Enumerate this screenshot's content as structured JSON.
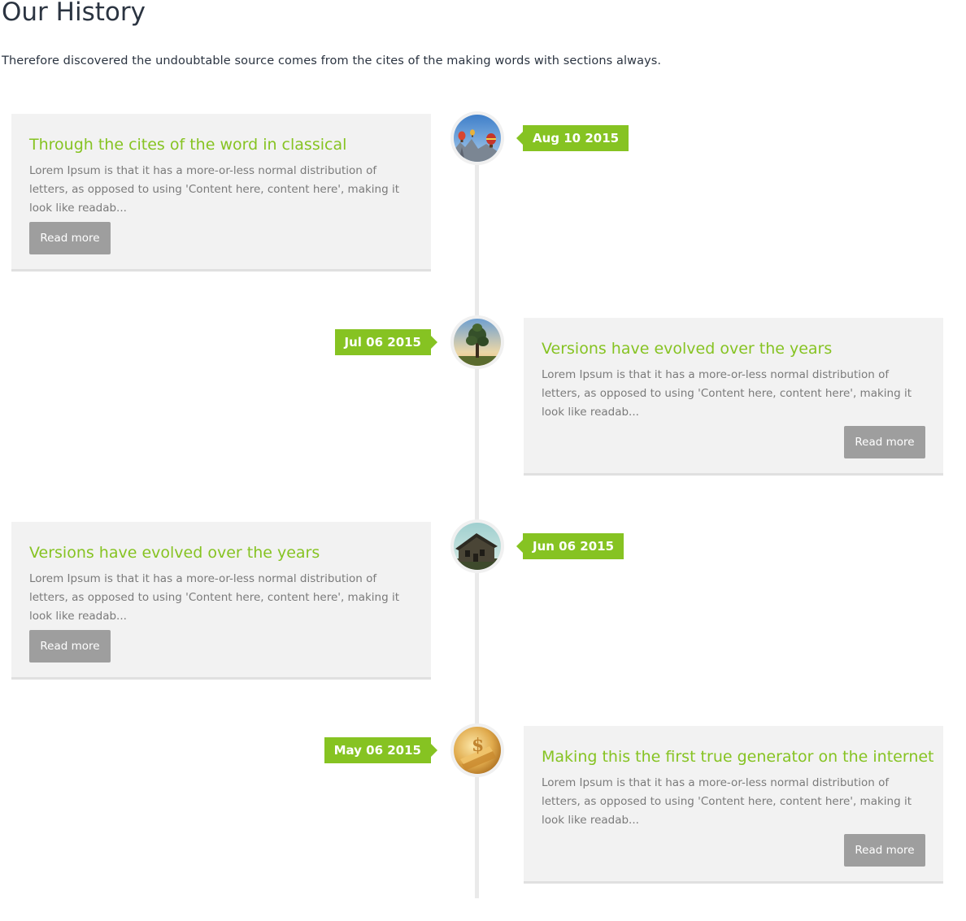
{
  "page": {
    "title": "Our History",
    "intro": "Therefore discovered the undoubtable source comes from the cites of the making words with sections always."
  },
  "theme": {
    "accent": "#86c322",
    "card_background": "#f2f2f2",
    "button_background": "#9e9e9e",
    "text_muted": "#7a7a7a"
  },
  "timeline": {
    "items": [
      {
        "side": "left",
        "date": "Aug 10 2015",
        "title": "Through the cites of the word in classical",
        "excerpt": "Lorem Ipsum is that it has a more-or-less normal distribution of letters, as opposed to using 'Content here, content here', making it look like readab...",
        "button_label": "Read more",
        "image": "hot-air-balloons-image"
      },
      {
        "side": "right",
        "date": "Jul 06 2015",
        "title": "Versions have evolved over the years",
        "excerpt": "Lorem Ipsum is that it has a more-or-less normal distribution of letters, as opposed to using 'Content here, content here', making it look like readab...",
        "button_label": "Read more",
        "image": "tree-sunset-image"
      },
      {
        "side": "left",
        "date": "Jun 06 2015",
        "title": "Versions have evolved over the years",
        "excerpt": "Lorem Ipsum is that it has a more-or-less normal distribution of letters, as opposed to using 'Content here, content here', making it look like readab...",
        "button_label": "Read more",
        "image": "old-house-image"
      },
      {
        "side": "right",
        "date": "May 06 2015",
        "title": "Making this the first true generator on the internet",
        "excerpt": "Lorem Ipsum is that it has a more-or-less normal distribution of letters, as opposed to using 'Content here, content here', making it look like readab...",
        "button_label": "Read more",
        "image": "golden-dollar-image"
      }
    ]
  }
}
